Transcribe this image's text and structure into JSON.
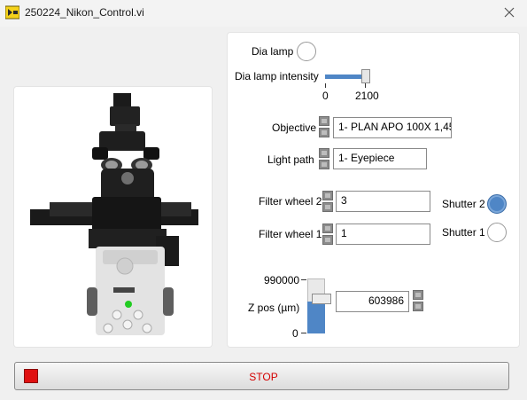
{
  "window": {
    "title": "250224_Nikon_Control.vi"
  },
  "icons": {
    "app": "labview-vi-icon",
    "close": "close-icon",
    "microscope": "microscope-image"
  },
  "colors": {
    "accent": "#4f86c6",
    "stop": "#e01010",
    "stop_text": "#d40000"
  },
  "controls": {
    "dia_lamp": {
      "label": "Dia lamp",
      "on": false
    },
    "dia_lamp_intensity": {
      "label": "Dia lamp intensity",
      "min": "0",
      "max": "2100",
      "value_fraction": 1.0
    },
    "objective": {
      "label": "Objective",
      "value": "1- PLAN APO 100X 1,45"
    },
    "light_path": {
      "label": "Light path",
      "value": "1- Eyepiece"
    },
    "filter_wheel_2": {
      "label": "Filter wheel 2",
      "value": "3"
    },
    "filter_wheel_1": {
      "label": "Filter wheel 1",
      "value": "1"
    },
    "shutter_2": {
      "label": "Shutter 2",
      "on": true
    },
    "shutter_1": {
      "label": "Shutter 1",
      "on": false
    },
    "z_pos": {
      "label": "Z pos (µm)",
      "max": "990000",
      "min": "0",
      "value": "603986",
      "value_fraction": 0.61
    }
  },
  "stop_button": {
    "label": "STOP"
  }
}
